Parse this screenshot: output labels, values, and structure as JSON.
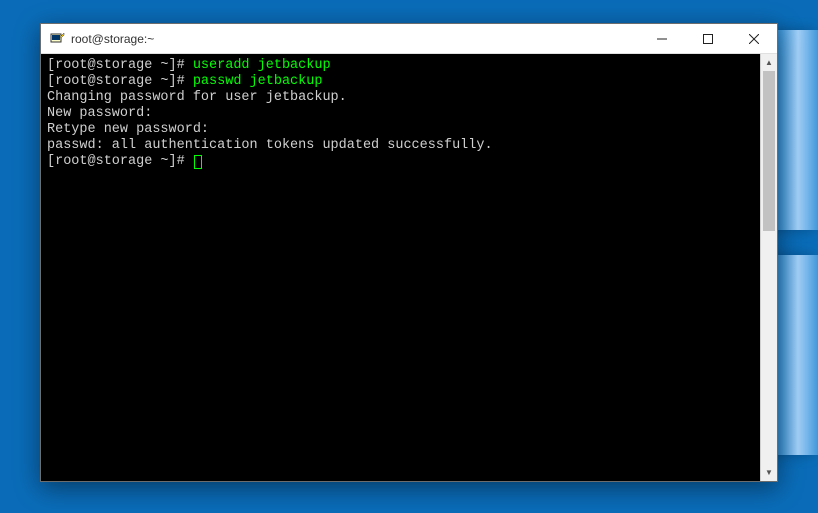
{
  "window": {
    "title": "root@storage:~"
  },
  "terminal": {
    "lines": [
      {
        "prompt": "[root@storage ~]# ",
        "cmd": "useradd jetbackup"
      },
      {
        "prompt": "[root@storage ~]# ",
        "cmd": "passwd jetbackup"
      },
      {
        "text": "Changing password for user jetbackup."
      },
      {
        "text": "New password:"
      },
      {
        "text": "Retype new password:"
      },
      {
        "text": "passwd: all authentication tokens updated successfully."
      },
      {
        "prompt": "[root@storage ~]# ",
        "cursor": true
      }
    ]
  }
}
